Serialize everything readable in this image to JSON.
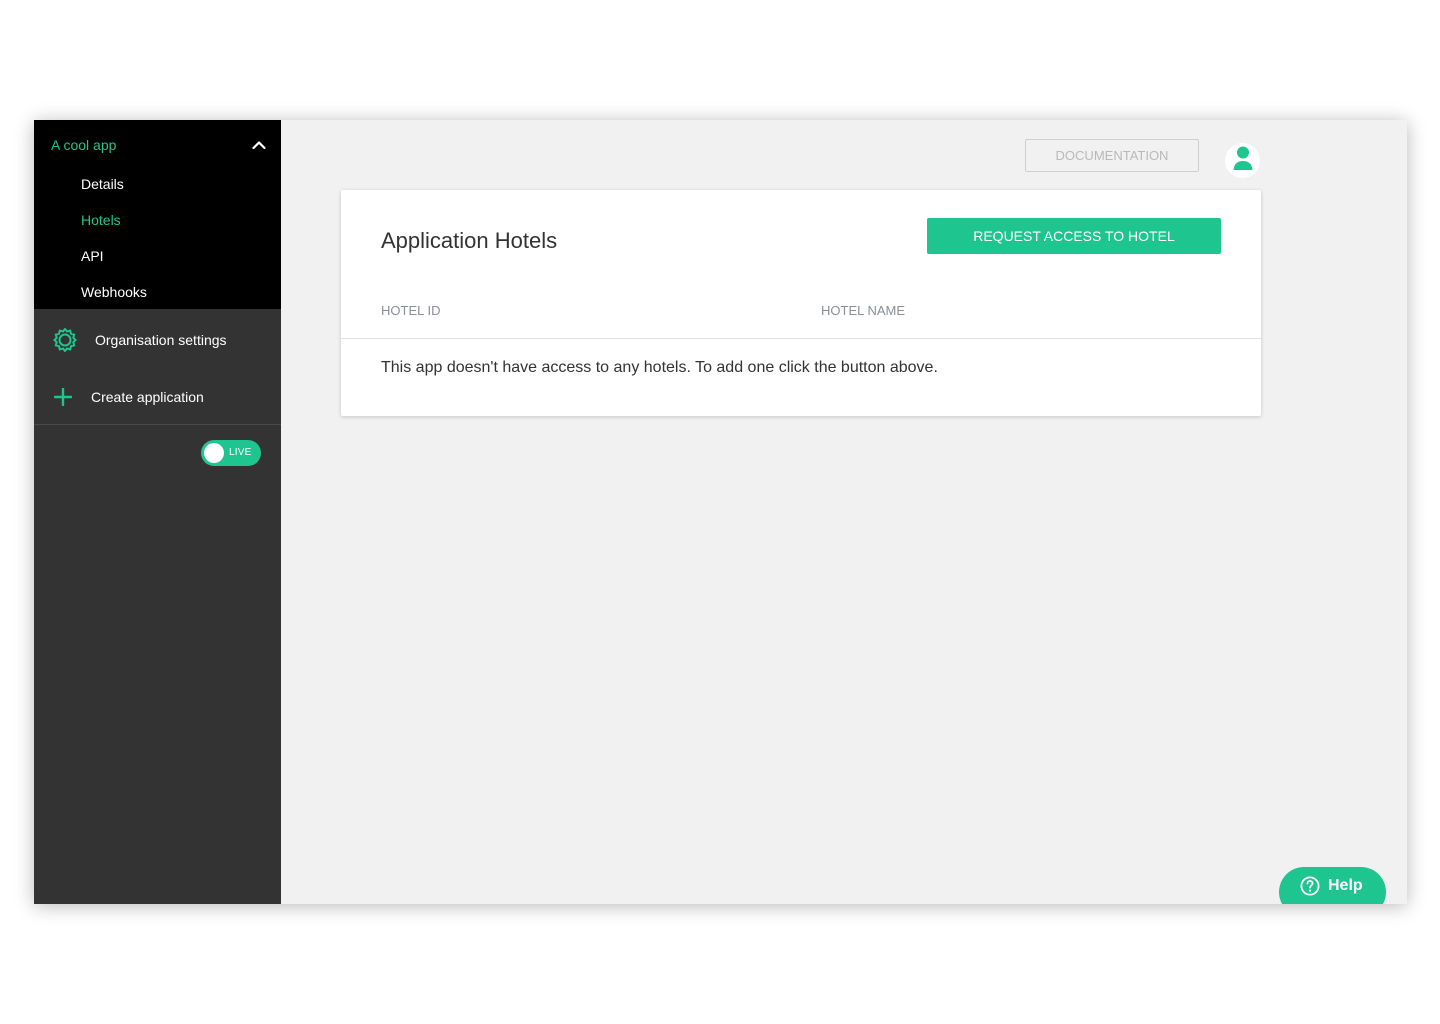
{
  "sidebar": {
    "app_title": "A cool app",
    "sub_items": [
      {
        "label": "Details"
      },
      {
        "label": "Hotels"
      },
      {
        "label": "API"
      },
      {
        "label": "Webhooks"
      }
    ],
    "active_item": "Hotels",
    "org_settings_label": "Organisation settings",
    "create_app_label": "Create application",
    "live_toggle": {
      "label": "LIVE",
      "on": true
    }
  },
  "topbar": {
    "documentation_label": "DOCUMENTATION"
  },
  "card": {
    "title": "Application Hotels",
    "request_button_label": "REQUEST ACCESS TO HOTEL",
    "columns": [
      "HOTEL ID",
      "HOTEL NAME"
    ],
    "empty_message": "This app doesn't have access to any hotels. To add one click the button above."
  },
  "help": {
    "label": "Help"
  },
  "colors": {
    "accent": "#1ec58e",
    "sidebar_top": "#000000",
    "sidebar": "#333333",
    "content_bg": "#f1f1f1"
  },
  "icons": {
    "collapse": "chevron-up-icon",
    "org_settings": "gear-icon",
    "create": "plus-icon",
    "avatar": "user-icon",
    "help": "question-circle-icon"
  }
}
